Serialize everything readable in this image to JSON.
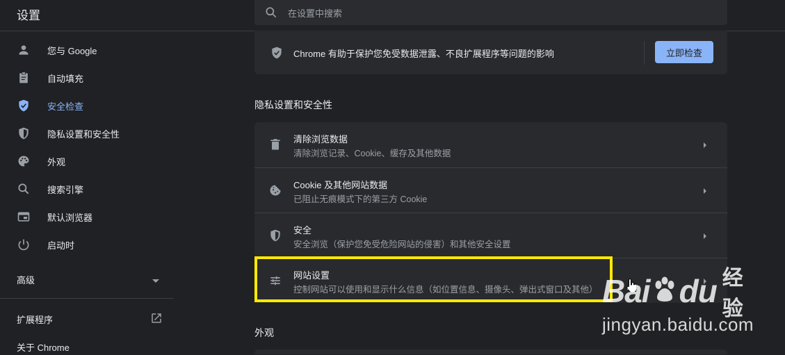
{
  "header": {
    "title": "设置",
    "search_placeholder": "在设置中搜索"
  },
  "sidebar": {
    "items": [
      {
        "label": "您与 Google",
        "icon": "person-icon"
      },
      {
        "label": "自动填充",
        "icon": "clipboard-icon"
      },
      {
        "label": "安全检查",
        "icon": "shield-check-icon",
        "active": true
      },
      {
        "label": "隐私设置和安全性",
        "icon": "shield-half-icon"
      },
      {
        "label": "外观",
        "icon": "palette-icon"
      },
      {
        "label": "搜索引擎",
        "icon": "search-icon"
      },
      {
        "label": "默认浏览器",
        "icon": "browser-icon"
      },
      {
        "label": "启动时",
        "icon": "power-icon"
      }
    ],
    "advanced": "高级",
    "extensions": "扩展程序",
    "about": "关于 Chrome"
  },
  "safety_check": {
    "text": "Chrome 有助于保护您免受数据泄露、不良扩展程序等问题的影响",
    "button": "立即检查"
  },
  "privacy": {
    "section_title": "隐私设置和安全性",
    "rows": [
      {
        "title": "清除浏览数据",
        "subtitle": "清除浏览记录、Cookie、缓存及其他数据",
        "icon": "trash-icon"
      },
      {
        "title": "Cookie 及其他网站数据",
        "subtitle": "已阻止无痕模式下的第三方 Cookie",
        "icon": "cookie-icon"
      },
      {
        "title": "安全",
        "subtitle": "安全浏览（保护您免受危险网站的侵害）和其他安全设置",
        "icon": "shield-half-icon"
      },
      {
        "title": "网站设置",
        "subtitle": "控制网站可以使用和显示什么信息（如位置信息、摄像头、弹出式窗口及其他）",
        "icon": "tune-icon"
      }
    ]
  },
  "appearance": {
    "section_title": "外观"
  },
  "watermark": {
    "brand_left": "Bai",
    "brand_right": "du",
    "brand_suffix": "经验",
    "url": "jingyan.baidu.com"
  },
  "colors": {
    "accent": "#8ab4f8",
    "background": "#202124",
    "card": "#292a2d",
    "highlight": "#ffea00"
  }
}
